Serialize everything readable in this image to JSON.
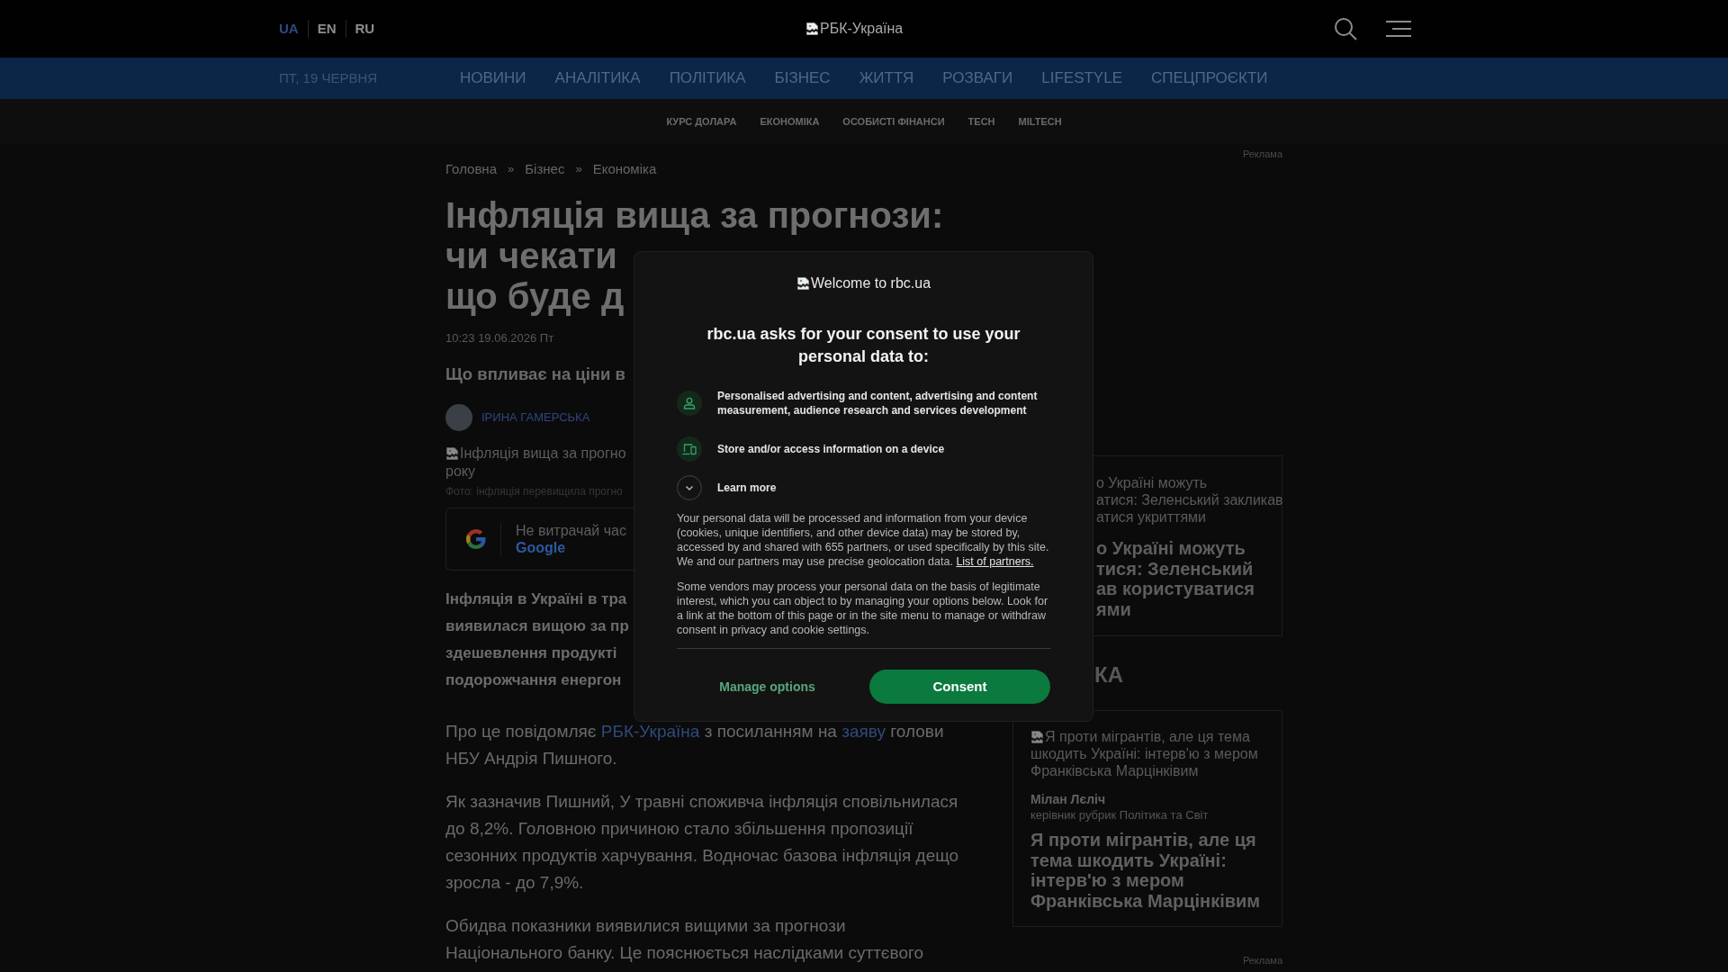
{
  "header": {
    "languages": [
      {
        "label": "UA",
        "selected": true
      },
      {
        "label": "EN",
        "selected": false
      },
      {
        "label": "RU",
        "selected": false
      }
    ],
    "logo_alt": "РБК-Україна"
  },
  "nav": {
    "date": "ПТ, 19 ЧЕРВНЯ",
    "items": [
      "НОВИНИ",
      "АНАЛІТИКА",
      "ПОЛІТИКА",
      "БІЗНЕС",
      "ЖИТТЯ",
      "РОЗВАГИ",
      "LIFESTYLE",
      "СПЕЦПРОЄКТИ"
    ]
  },
  "subnav": {
    "items": [
      "КУРС ДОЛАРА",
      "ЕКОНОМІКА",
      "ОСОБИСТІ ФІНАНСИ",
      "TECH",
      "MILTECH"
    ]
  },
  "breadcrumbs": [
    {
      "kind": "link",
      "text": "Головна"
    },
    {
      "kind": "separator",
      "text": "»"
    },
    {
      "kind": "link",
      "text": "Бізнес"
    },
    {
      "kind": "separator",
      "text": "»"
    },
    {
      "kind": "link",
      "text": "Економіка"
    }
  ],
  "article": {
    "title_lines": [
      "Інфляція вища за прогнози:",
      "чи чекати",
      "що буде д"
    ],
    "date": "10:23 19.06.2026 Пт",
    "subtitle": "Що впливає на ціни в",
    "author": "ІРИНА ГАМЕРСЬКА",
    "image_alt_lines": [
      "Інфляція вища за прогно",
      "року"
    ],
    "image_caption": "Фото: інфляція перевищила прогно",
    "google_banner": {
      "text": "Не витрачай час",
      "link": "Google"
    },
    "lead_lines": [
      "Інфляція в Україні в тра",
      "виявилася вищою за пр",
      "здешевлення продукті",
      "подорожчання енергон"
    ],
    "paragraphs": [
      [
        {
          "kind": "text",
          "text": "Про це повідомляє "
        },
        {
          "kind": "link",
          "text": "РБК-Україна"
        },
        {
          "kind": "text",
          "text": " з посиланням на "
        },
        {
          "kind": "link",
          "text": "заяву"
        },
        {
          "kind": "text",
          "text": " голови НБУ Андрія Пишного."
        }
      ],
      [
        {
          "kind": "text",
          "text": "Як зазначив Пишний, У травні споживча інфляція сповільнилася до 8,2%. Головною причиною стало збільшення пропозиції сезонних продуктів харчування. Водночас базова інфляція дещо зросла - до 7,9%."
        }
      ],
      [
        {
          "kind": "text",
          "text": "Обидва показники виявилися вищими за прогнози Національного банку. Це пояснюється наслідками суттєвого"
        }
      ]
    ]
  },
  "sidebar": {
    "ad_label": "Реклама",
    "top_card": {
      "image_alt_lines": [
        "о Україні можуть",
        "атися: Зеленський закликав",
        "атися укриттями"
      ],
      "title_lines": [
        "о Україні можуть",
        "тися: Зеленський",
        "ав користуватися",
        "ями"
      ]
    },
    "section_title": "КА",
    "interview_card": {
      "image_alt_lines": [
        "Я проти мігрантів, але ця тема",
        "шкодить Україні: інтерв'ю з мером",
        "Франківська Марцінківим"
      ],
      "author": "Мілан Лєліч",
      "author_role": "керівник рубрик Політика та Світ",
      "title": "Я проти мігрантів, але ця тема шкодить Україні: інтерв'ю з мером Франківська Марцінківим"
    },
    "bottom_ad_label": "Реклама"
  },
  "consent_dialog": {
    "logo_alt": "Welcome to rbc.ua",
    "heading": "rbc.ua asks for your consent to use your personal data to:",
    "purposes": [
      {
        "kind": "person",
        "text": "Personalised advertising and content, advertising and content measurement, audience research and services development"
      },
      {
        "kind": "device",
        "text": "Store and/or access information on a device"
      }
    ],
    "learn_more": {
      "label": "Learn more",
      "expanded": false
    },
    "paragraphs": [
      [
        {
          "kind": "text",
          "text": "Your personal data will be processed and information from your device (cookies, unique identifiers, and other device data) may be stored by, accessed by and shared with 655 partners, or used specifically by this site. We and our partners may use precise geolocation data. "
        },
        {
          "kind": "link",
          "text": "List of partners."
        }
      ],
      [
        {
          "kind": "text",
          "text": "Some vendors may process your personal data on the basis of legitimate interest, which you can object to by managing your options below. Look for a link at the bottom of this page or in the site menu to manage or withdraw consent in privacy and cookie settings."
        }
      ]
    ],
    "buttons": [
      {
        "kind": "secondary",
        "label": "Manage options"
      },
      {
        "kind": "primary",
        "label": "Consent"
      }
    ]
  }
}
